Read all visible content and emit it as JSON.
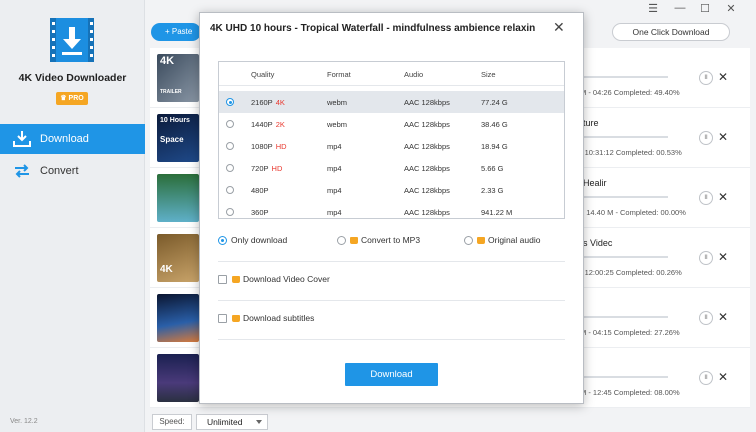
{
  "app": {
    "name": "4K Video Downloader",
    "badge": "PRO",
    "version": "Ver. 12.2"
  },
  "nav": [
    {
      "label": "Download",
      "active": true
    },
    {
      "label": "Convert",
      "active": false
    }
  ],
  "toolbar": {
    "paste": "+ Paste",
    "one_click": "One Click Download",
    "minimize": "—",
    "maximize": "☐",
    "close": "✕",
    "menu": "☰"
  },
  "downloads": [
    {
      "title": "",
      "meta": "M - 04:26   Completed: 49.40%",
      "thumb_text": "4K",
      "thumb_sub": "TRAILER"
    },
    {
      "title": "ture",
      "meta": "- 10:31:12   Completed: 00.53%",
      "thumb_text": "10 Hours",
      "thumb_sub": "Space"
    },
    {
      "title": "Healir",
      "meta": "7 14.40 M -   Completed: 00.00%",
      "thumb_text": "",
      "thumb_sub": ""
    },
    {
      "title": "s Videc",
      "meta": "- 12:00:25   Completed: 00.26%",
      "thumb_text": "4K",
      "thumb_sub": ""
    },
    {
      "title": "",
      "meta": "M - 04:15   Completed: 27.26%",
      "thumb_text": "",
      "thumb_sub": ""
    },
    {
      "title": "",
      "meta": "M - 12:45   Completed: 08.00%",
      "thumb_text": "",
      "thumb_sub": ""
    }
  ],
  "speed": {
    "label": "Speed:",
    "value": "Unlimited"
  },
  "modal": {
    "title": "4K UHD 10 hours - Tropical Waterfall - mindfulness ambience relaxin",
    "columns": [
      "Quality",
      "Format",
      "Audio",
      "Size"
    ],
    "rows": [
      {
        "quality": "2160P",
        "tag": "4K",
        "format": "webm",
        "audio": "AAC 128kbps",
        "size": "77.24 G",
        "selected": true
      },
      {
        "quality": "1440P",
        "tag": "2K",
        "format": "webm",
        "audio": "AAC 128kbps",
        "size": "38.46 G",
        "selected": false
      },
      {
        "quality": "1080P",
        "tag": "HD",
        "format": "mp4",
        "audio": "AAC 128kbps",
        "size": "18.94 G",
        "selected": false
      },
      {
        "quality": "720P",
        "tag": "HD",
        "format": "mp4",
        "audio": "AAC 128kbps",
        "size": "5.66 G",
        "selected": false
      },
      {
        "quality": "480P",
        "tag": "",
        "format": "mp4",
        "audio": "AAC 128kbps",
        "size": "2.33 G",
        "selected": false
      },
      {
        "quality": "360P",
        "tag": "",
        "format": "mp4",
        "audio": "AAC 128kbps",
        "size": "941.22 M",
        "selected": false
      }
    ],
    "options": {
      "only_download": "Only download",
      "convert_mp3": "Convert to MP3",
      "original_audio": "Original audio"
    },
    "checks": {
      "video_cover": "Download Video Cover",
      "subtitles": "Download subtitles"
    },
    "download_button": "Download"
  },
  "colors": {
    "accent": "#1f95e6",
    "pro": "#f5a623",
    "tag": "#e8392f"
  }
}
